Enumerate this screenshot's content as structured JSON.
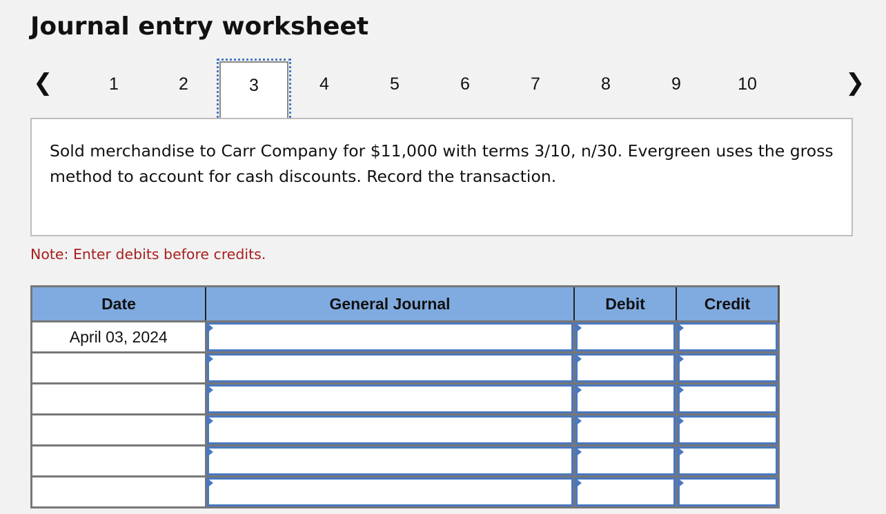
{
  "title": "Journal entry worksheet",
  "nav": {
    "prev_icon": "chevron-left-icon",
    "next_icon": "chevron-right-icon",
    "steps": [
      "1",
      "2",
      "3",
      "4",
      "5",
      "6",
      "7",
      "8",
      "9",
      "10"
    ],
    "active_step": "3"
  },
  "question": "Sold merchandise to Carr Company for $11,000 with terms 3/10, n/30. Evergreen uses the gross method to account for cash discounts. Record the transaction.",
  "note": "Note: Enter debits before credits.",
  "table": {
    "headers": [
      "Date",
      "General Journal",
      "Debit",
      "Credit"
    ],
    "rows": [
      {
        "date": "April 03, 2024",
        "account": "",
        "debit": "",
        "credit": ""
      },
      {
        "date": "",
        "account": "",
        "debit": "",
        "credit": ""
      },
      {
        "date": "",
        "account": "",
        "debit": "",
        "credit": ""
      },
      {
        "date": "",
        "account": "",
        "debit": "",
        "credit": ""
      },
      {
        "date": "",
        "account": "",
        "debit": "",
        "credit": ""
      },
      {
        "date": "",
        "account": "",
        "debit": "",
        "credit": ""
      }
    ]
  },
  "colors": {
    "header_bg": "#80abe0",
    "input_border": "#4a78c0",
    "note": "#a81e1e"
  }
}
